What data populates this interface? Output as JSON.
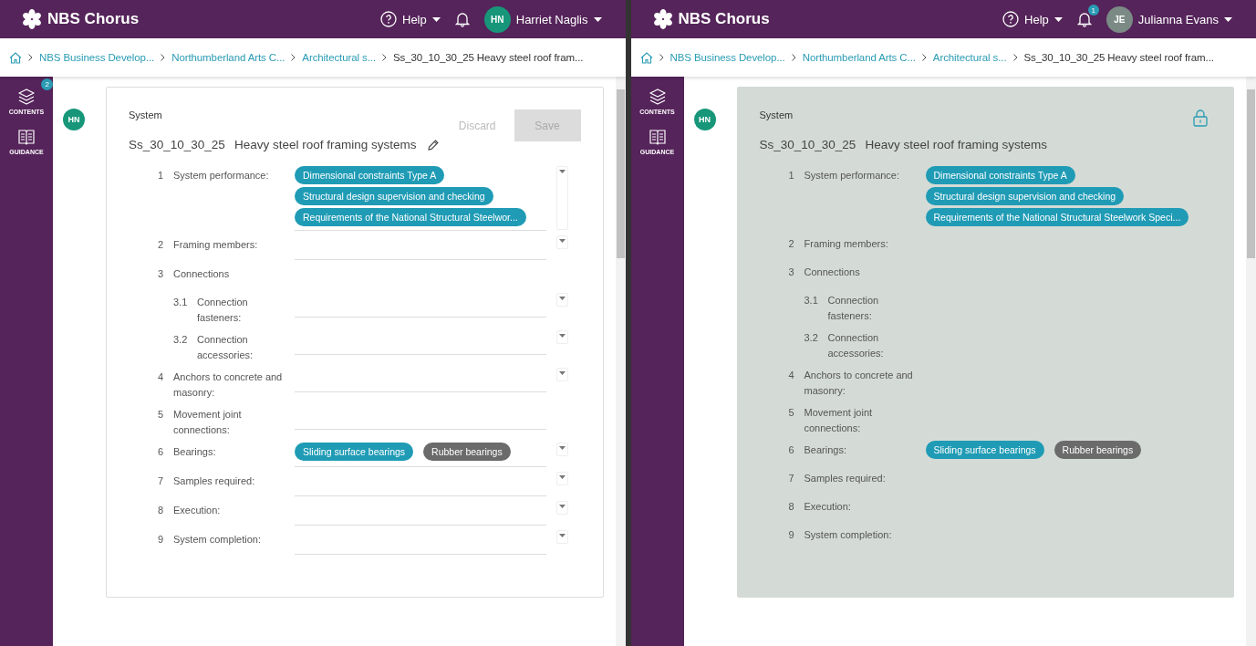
{
  "windows": [
    {
      "app_name": "NBS Chorus",
      "help": "Help",
      "user": {
        "initials": "HN",
        "name": "Harriet Naglis",
        "color": "#17967a"
      },
      "breadcrumbs": [
        "NBS Business Develop...",
        "Northumberland Arts C...",
        "Architectural s..."
      ],
      "current_page": "Ss_30_10_30_25 Heavy steel roof fram...",
      "sidebar": [
        {
          "kind": "contents",
          "label": "CONTENTS",
          "badge": "2"
        },
        {
          "kind": "guidance",
          "label": "GUIDANCE"
        }
      ],
      "card": {
        "kind": "editable",
        "author": {
          "initials": "HN",
          "color": "#17967a"
        },
        "label": "System",
        "code": "Ss_30_10_30_25",
        "title": "Heavy steel roof framing systems",
        "discard": "Discard",
        "save": {
          "label": "Save",
          "disabled": true
        },
        "items": [
          {
            "number": "1",
            "label": "System performance:",
            "field": true,
            "dropdown": true,
            "chips": [
              {
                "text": "Dimensional constraints Type A",
                "color": "#1f9bb5"
              },
              {
                "text": "Structural design supervision and checking",
                "color": "#1f9bb5"
              },
              {
                "text": "Requirements of the National Structural Steelwor...",
                "color": "#1f9bb5"
              }
            ]
          },
          {
            "number": "2",
            "label": "Framing members:",
            "field": true,
            "dropdown": true
          },
          {
            "number": "3",
            "label": "Connections",
            "field": false,
            "dropdown": false,
            "children": [
              {
                "number": "3.1",
                "label": "Connection fasteners:",
                "field": true,
                "dropdown": true
              },
              {
                "number": "3.2",
                "label": "Connection accessories:",
                "field": true,
                "dropdown": true
              }
            ]
          },
          {
            "number": "4",
            "label": "Anchors to concrete and masonry:",
            "field": true,
            "dropdown": true
          },
          {
            "number": "5",
            "label": "Movement joint connections:",
            "field": true,
            "dropdown": false
          },
          {
            "number": "6",
            "label": "Bearings:",
            "field": true,
            "dropdown": true,
            "chips": [
              {
                "text": "Sliding surface bearings",
                "color": "#1f9bb5"
              },
              {
                "text": "Rubber bearings",
                "color": "#6b6b6b"
              }
            ]
          },
          {
            "number": "7",
            "label": "Samples required:",
            "field": true,
            "dropdown": true
          },
          {
            "number": "8",
            "label": "Execution:",
            "field": true,
            "dropdown": true
          },
          {
            "number": "9",
            "label": "System completion:",
            "field": true,
            "dropdown": true
          }
        ]
      }
    },
    {
      "app_name": "NBS Chorus",
      "help": "Help",
      "notification_count": "1",
      "user": {
        "initials": "JE",
        "name": "Julianna Evans",
        "color": "#7b8a85"
      },
      "breadcrumbs": [
        "NBS Business Develop...",
        "Northumberland Arts C...",
        "Architectural s..."
      ],
      "current_page": "Ss_30_10_30_25 Heavy steel roof fram...",
      "sidebar": [
        {
          "kind": "contents",
          "label": "CONTENTS"
        },
        {
          "kind": "guidance",
          "label": "GUIDANCE"
        }
      ],
      "card": {
        "kind": "locked",
        "author": {
          "initials": "HN",
          "color": "#17967a"
        },
        "label": "System",
        "code": "Ss_30_10_30_25",
        "title": "Heavy steel roof framing systems",
        "items": [
          {
            "number": "1",
            "label": "System performance:",
            "chips": [
              {
                "text": "Dimensional constraints Type A",
                "color": "#1f9bb5"
              },
              {
                "text": "Structural design supervision and checking",
                "color": "#1f9bb5"
              },
              {
                "text": "Requirements of the National Structural Steelwork Speci...",
                "color": "#1f9bb5"
              }
            ]
          },
          {
            "number": "2",
            "label": "Framing members:"
          },
          {
            "number": "3",
            "label": "Connections",
            "children": [
              {
                "number": "3.1",
                "label": "Connection fasteners:"
              },
              {
                "number": "3.2",
                "label": "Connection accessories:"
              }
            ]
          },
          {
            "number": "4",
            "label": "Anchors to concrete and masonry:"
          },
          {
            "number": "5",
            "label": "Movement joint connections:"
          },
          {
            "number": "6",
            "label": "Bearings:",
            "chips": [
              {
                "text": "Sliding surface bearings",
                "color": "#1f9bb5"
              },
              {
                "text": "Rubber bearings",
                "color": "#6b6b6b"
              }
            ]
          },
          {
            "number": "7",
            "label": "Samples required:"
          },
          {
            "number": "8",
            "label": "Execution:"
          },
          {
            "number": "9",
            "label": "System completion:"
          }
        ]
      }
    }
  ]
}
